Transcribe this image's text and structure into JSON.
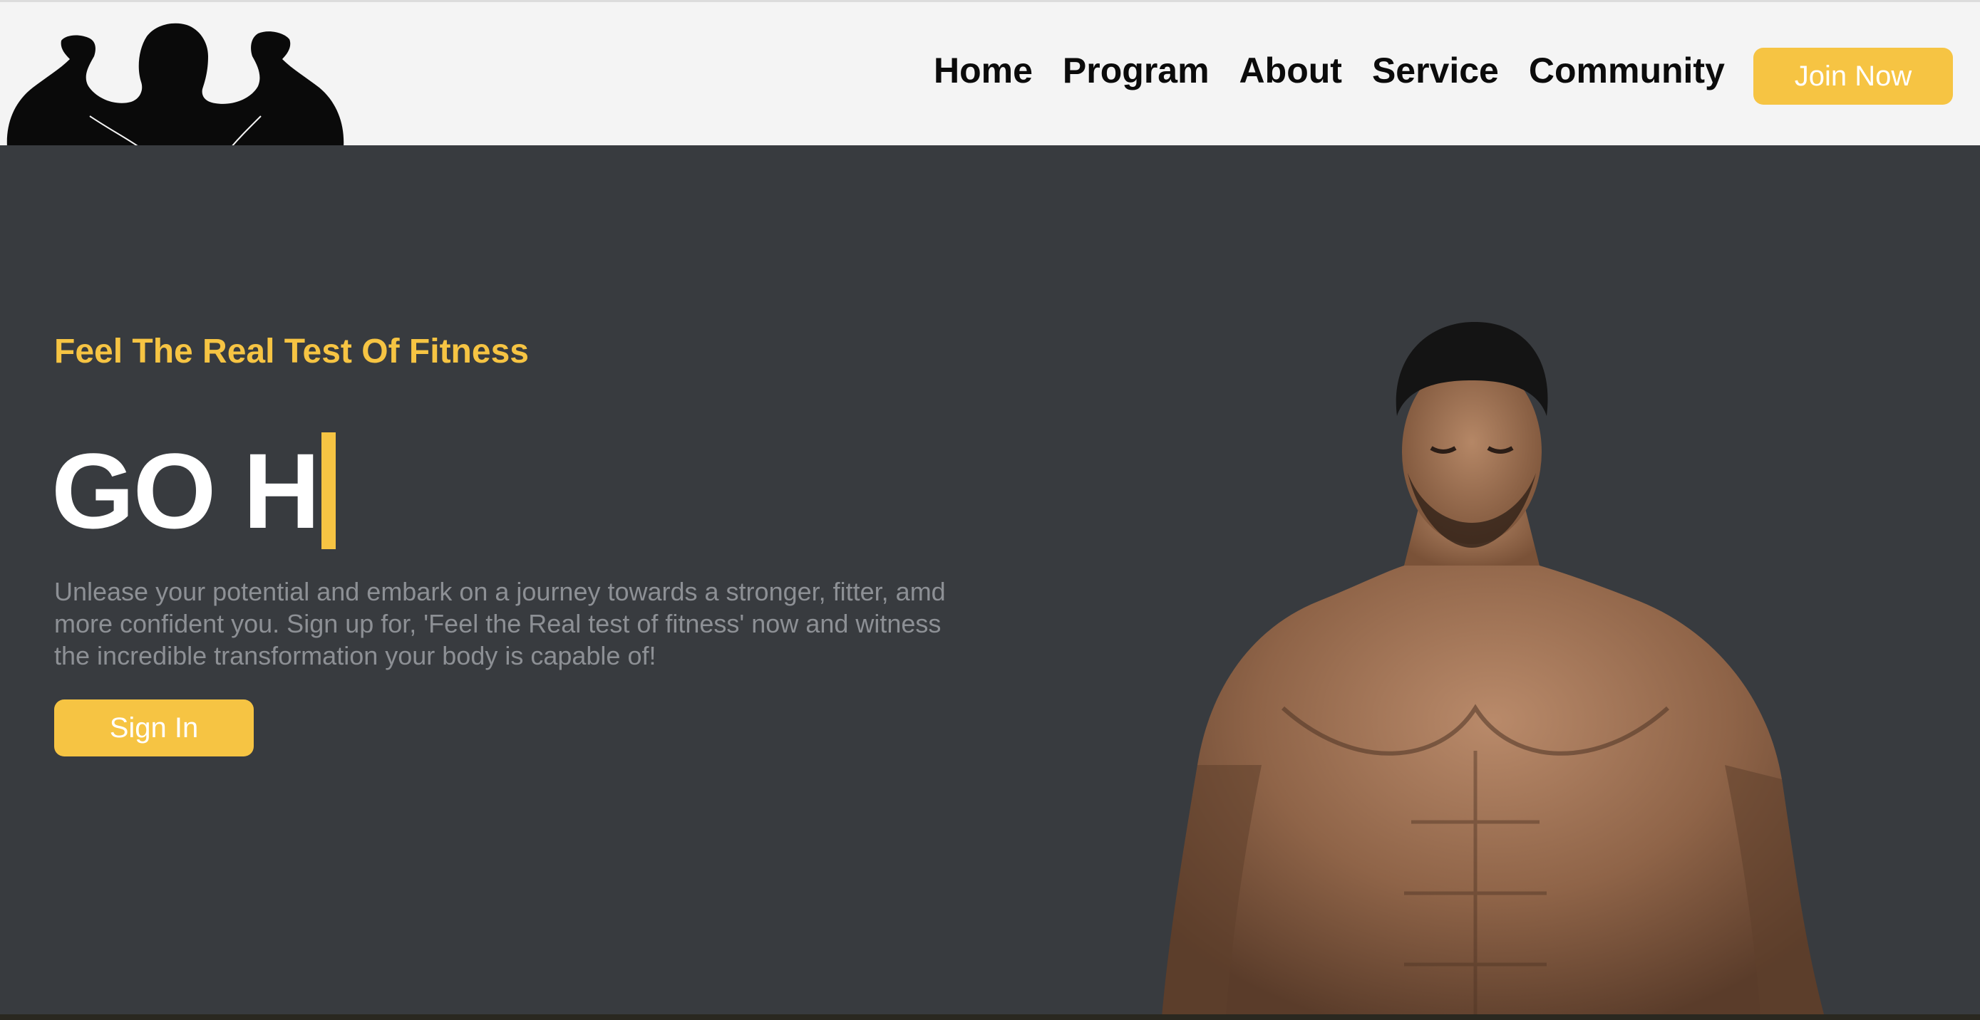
{
  "nav": {
    "links": [
      "Home",
      "Program",
      "About",
      "Service",
      "Community"
    ],
    "cta_label": "Join Now"
  },
  "hero": {
    "tagline": "Feel The Real Test Of Fitness",
    "headline": "GO H",
    "description": "Unlease your potential and embark on a journey towards a stronger, fitter, amd more confident you. Sign up for, 'Feel the Real test of fitness' now and witness the incredible transformation your body is capable of!",
    "signin_label": "Sign In"
  },
  "colors": {
    "accent": "#f6c443",
    "hero_bg": "#383b3f",
    "nav_bg": "#f4f4f4",
    "nav_text": "#0b0b0b",
    "muted_text": "#8d9095"
  },
  "icons": {
    "logo": "flexing-bodybuilder-silhouette-icon",
    "hero_image": "muscular-man-photo"
  }
}
